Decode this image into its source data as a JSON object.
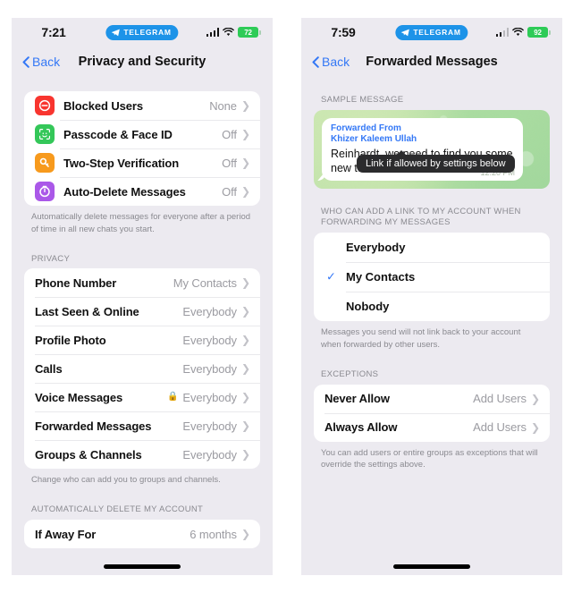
{
  "left": {
    "status": {
      "time": "7:21",
      "carrier_pill": "TELEGRAM",
      "battery": "72",
      "signal_icon": "cellular-bars-icon",
      "wifi_icon": "wifi-icon",
      "battery_icon": "battery-icon"
    },
    "nav": {
      "back": "Back",
      "title": "Privacy and Security"
    },
    "security_rows": [
      {
        "label": "Blocked Users",
        "value": "None",
        "icon": "blocked-users-icon",
        "color": "#f8352f"
      },
      {
        "label": "Passcode & Face ID",
        "value": "Off",
        "icon": "face-id-icon",
        "color": "#34c759"
      },
      {
        "label": "Two-Step Verification",
        "value": "Off",
        "icon": "key-icon",
        "color": "#f79a1d"
      },
      {
        "label": "Auto-Delete Messages",
        "value": "Off",
        "icon": "timer-icon",
        "color": "#aa58e8"
      }
    ],
    "security_footer": "Automatically delete messages for everyone after a period of time in all new chats you start.",
    "privacy_header": "PRIVACY",
    "privacy_rows": [
      {
        "label": "Phone Number",
        "value": "My Contacts",
        "lock": false
      },
      {
        "label": "Last Seen & Online",
        "value": "Everybody",
        "lock": false
      },
      {
        "label": "Profile Photo",
        "value": "Everybody",
        "lock": false
      },
      {
        "label": "Calls",
        "value": "Everybody",
        "lock": false
      },
      {
        "label": "Voice Messages",
        "value": "Everybody",
        "lock": true
      },
      {
        "label": "Forwarded Messages",
        "value": "Everybody",
        "lock": false
      },
      {
        "label": "Groups & Channels",
        "value": "Everybody",
        "lock": false
      }
    ],
    "privacy_footer": "Change who can add you to groups and channels.",
    "delete_header": "AUTOMATICALLY DELETE MY ACCOUNT",
    "delete_rows": [
      {
        "label": "If Away For",
        "value": "6 months"
      }
    ]
  },
  "right": {
    "status": {
      "time": "7:59",
      "carrier_pill": "TELEGRAM",
      "battery": "92",
      "signal_icon": "cellular-bars-icon",
      "wifi_icon": "wifi-icon",
      "battery_icon": "battery-icon"
    },
    "nav": {
      "back": "Back",
      "title": "Forwarded Messages"
    },
    "sample_header": "SAMPLE MESSAGE",
    "sample": {
      "forwarded_from_label": "Forwarded From",
      "forwarded_from_name": "Khizer Kaleem Ullah",
      "text": "Reinhardt, we need to find you some new tunes.",
      "time": "12:20 PM",
      "tooltip": "Link if allowed by settings below"
    },
    "options_header": "WHO CAN ADD A LINK TO MY ACCOUNT WHEN FORWARDING MY MESSAGES",
    "options": [
      {
        "label": "Everybody",
        "selected": false
      },
      {
        "label": "My Contacts",
        "selected": true
      },
      {
        "label": "Nobody",
        "selected": false
      }
    ],
    "options_footer": "Messages you send will not link back to your account when forwarded by other users.",
    "exceptions_header": "EXCEPTIONS",
    "exception_rows": [
      {
        "label": "Never Allow",
        "value": "Add Users"
      },
      {
        "label": "Always Allow",
        "value": "Add Users"
      }
    ],
    "exceptions_footer": "You can add users or entire groups as exceptions that will override the settings above."
  },
  "colors": {
    "accent_blue": "#3478f6",
    "telegram_blue": "#1d93e8",
    "screen_bg": "#eceaf0",
    "card_bg": "#ffffff",
    "battery_green": "#2ecb57"
  }
}
